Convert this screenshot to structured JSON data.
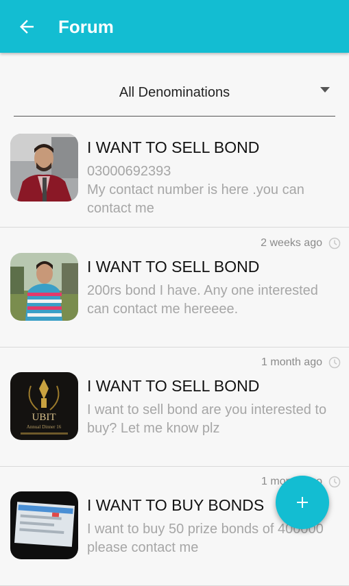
{
  "appbar": {
    "title": "Forum",
    "back_icon": "arrow-left-icon"
  },
  "filter": {
    "selected": "All Denominations",
    "icon": "caret-down-icon"
  },
  "posts": [
    {
      "title": "I WANT TO SELL BOND",
      "phone": "03000692393",
      "body": "My contact number is here .you can contact me",
      "time": ""
    },
    {
      "title": "I WANT TO SELL BOND",
      "body": "200rs bond I have. Any one interested can contact me hereeee.",
      "time": "2 weeks ago"
    },
    {
      "title": "I WANT TO SELL BOND",
      "body": "I want to sell bond are you interested to buy? Let me know plz",
      "time": "1 month ago",
      "avatar_text": "UBIT",
      "avatar_subtext": "Annual Dinner 16"
    },
    {
      "title": "I WANT TO BUY BONDS",
      "body": "I want to buy 50 prize bonds of 400000 please contact me",
      "time": "1 month ago"
    }
  ],
  "fab": {
    "icon": "plus-icon"
  },
  "colors": {
    "primary": "#13bdd2",
    "title_text": "#111111",
    "body_text": "#a6a6a6"
  }
}
